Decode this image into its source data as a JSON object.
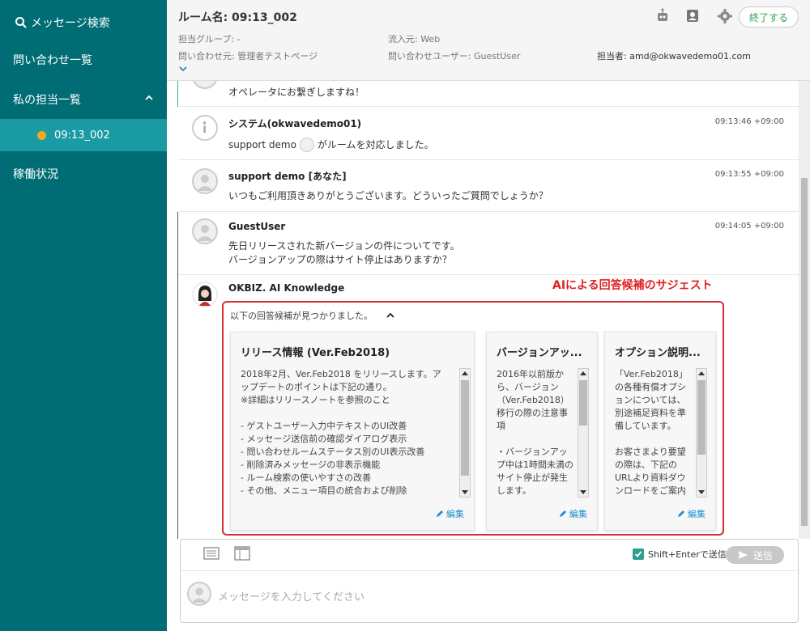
{
  "sidebar": {
    "search_label": "メッセージ検索",
    "inquiry_list": "問い合わせ一覧",
    "my_assignments": "私の担当一覧",
    "active_room": "09:13_002",
    "status": "稼働状況"
  },
  "header": {
    "room_title": "ルーム名: 09:13_002",
    "group": "担当グループ: -",
    "source": "流入元: Web",
    "inquiry_from": "問い合わせ元: 管理者テストページ",
    "inquiry_user": "問い合わせユーザー: GuestUser",
    "assignee": "担当者: amd@okwavedemo01.com",
    "end_button": "終了する"
  },
  "messages": [
    {
      "text": "オペレータにお繋ぎしますね！"
    },
    {
      "name": "システム(okwavedemo01)",
      "time": "09:13:46 +09:00",
      "text_pre": "support demo",
      "text_post": "がルームを対応しました。"
    },
    {
      "name": "support demo [あなた]",
      "time": "09:13:55 +09:00",
      "text": "いつもご利用頂きありがとうございます。どういったご質問でしょうか？"
    },
    {
      "name": "GuestUser",
      "time": "09:14:05 +09:00",
      "text1": "先日リリースされた新バージョンの件についてです。",
      "text2": "バージョンアップの際はサイト停止はありますか？"
    },
    {
      "name": "OKBIZ. AI Knowledge"
    }
  ],
  "suggest": {
    "annotation": "AIによる回答候補のサジェスト",
    "header": "以下の回答候補が見つかりました。",
    "edit_label": "編集",
    "cards": [
      {
        "title": "リリース情報 (Ver.Feb2018)",
        "body": "2018年2月、Ver.Feb2018 をリリースします。アップデートのポイントは下記の通り。\n※詳細はリリースノートを参照のこと\n\n- ゲストユーザー入力中テキストのUI改善\n- メッセージ送信前の確認ダイアログ表示\n- 問い合わせルームステータス別のUI表示改善\n- 削除済みメッセージの非表示機能\n- ルーム検索の使いやすさの改善\n- その他、メニュー項目の統合および削除"
      },
      {
        "title": "バージョンアッ...",
        "body": "2016年以前版から、バージョン\n（Ver.Feb2018）移行の際の注意事項\n\n・バージョンアップ中は1時間未満のサイト停止が発生します。\n・一部の管理機能に"
      },
      {
        "title": "オプション説明...",
        "body": "「Ver.Feb2018」の各種有償オプションについては、別途補足資料を準備しています。\n\nお客さまより要望の際は、下記のURLより資料ダウンロードをご案内ください。"
      }
    ]
  },
  "composer": {
    "shift_enter": "Shift+Enterで送信",
    "send": "送信",
    "placeholder": "メッセージを入力してください"
  },
  "colors": {
    "sidebar": "#006d75",
    "sidebar_active": "#1a9aa3",
    "suggest_border": "#d32f2f",
    "link": "#1a8fd1"
  }
}
